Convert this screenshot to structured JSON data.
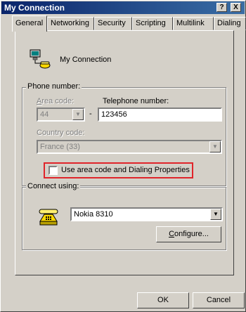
{
  "window": {
    "title": "My Connection",
    "help_label": "?",
    "close_label": "X"
  },
  "tabs": [
    {
      "label": "General"
    },
    {
      "label": "Networking"
    },
    {
      "label": "Security"
    },
    {
      "label": "Scripting"
    },
    {
      "label": "Multilink"
    },
    {
      "label": "Dialing"
    }
  ],
  "connection": {
    "name": "My Connection",
    "icon": "network-connection-icon"
  },
  "phone": {
    "group_label": "Phone number:",
    "area_code_label": "Area code:",
    "area_code_value": "44",
    "telephone_label": "Telephone number:",
    "telephone_value": "123456",
    "dash": "-",
    "country_label": "Country code:",
    "country_value": "France (33)",
    "use_area_code_label": "Use area code and Dialing Properties",
    "use_area_code_checked": false
  },
  "connect": {
    "group_label": "Connect using:",
    "device_value": "Nokia 8310",
    "device_icon": "modem-phone-icon",
    "configure_label": "Configure..."
  },
  "footer": {
    "ok_label": "OK",
    "cancel_label": "Cancel"
  },
  "colors": {
    "titlebar_start": "#0a246a",
    "titlebar_end": "#3a6ea5",
    "face": "#d4d0c8",
    "highlight_box": "#e0242a"
  }
}
